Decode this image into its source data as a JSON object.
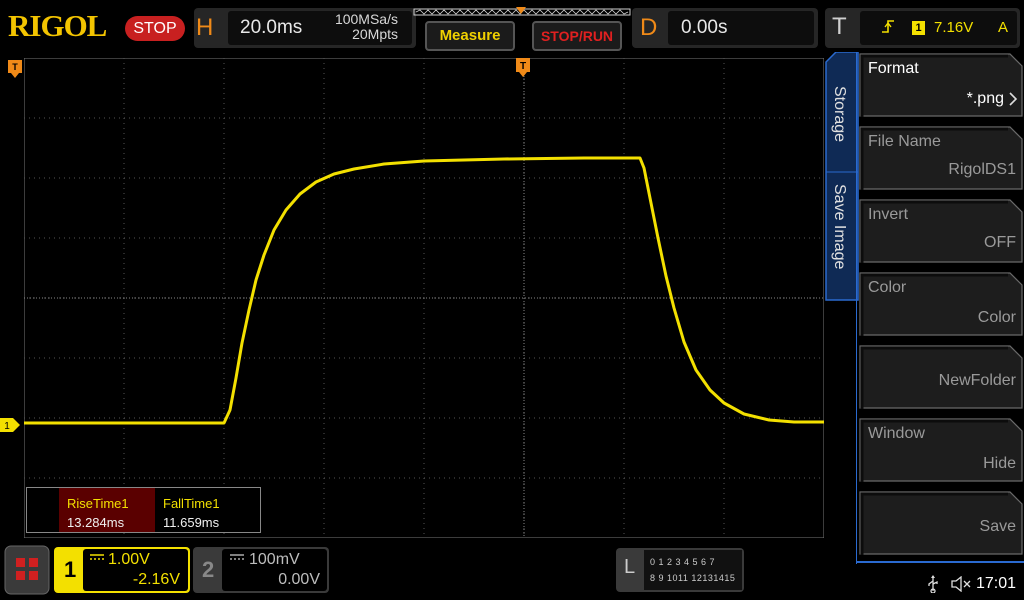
{
  "brand": {
    "logo": "RIGOL"
  },
  "run_state": {
    "badge": "STOP"
  },
  "horizontal": {
    "letter": "H",
    "timebase": "20.0ms",
    "sample_rate": "100MSa/s",
    "memory_depth": "20Mpts"
  },
  "buttons": {
    "measure": "Measure",
    "stop_run": "STOP/RUN"
  },
  "delay": {
    "letter": "D",
    "value": "0.00s"
  },
  "trigger": {
    "letter": "T",
    "channel": "1",
    "level": "7.16V",
    "mode": "A"
  },
  "measurements": [
    {
      "name": "RiseTime1",
      "value": "13.284ms"
    },
    {
      "name": "FallTime1",
      "value": "11.659ms"
    }
  ],
  "side_menu": {
    "tabs": [
      "Storage",
      "Save Image"
    ],
    "items": [
      {
        "label": "Format",
        "value": "*.png"
      },
      {
        "label": "File Name",
        "value": "RigolDS1"
      },
      {
        "label": "Invert",
        "value": "OFF"
      },
      {
        "label": "Color",
        "value": "Color"
      },
      {
        "label": "",
        "value": "NewFolder"
      },
      {
        "label": "Window",
        "value": "Hide"
      },
      {
        "label": "",
        "value": "Save"
      }
    ]
  },
  "channels": [
    {
      "number": "1",
      "scale": "1.00V",
      "offset": "-2.16V",
      "color": "#f3e000"
    },
    {
      "number": "2",
      "scale": "100mV",
      "offset": "0.00V",
      "color": "#00e0ff"
    }
  ],
  "logic": {
    "letter": "L",
    "row1": "0 1 2 3  4 5 6 7",
    "row2": "8 9 1011 12131415"
  },
  "status": {
    "time": "17:01"
  },
  "markers": {
    "ch1": "1"
  },
  "colors": {
    "accent": "#f08a18",
    "ch1": "#f3e000",
    "stop": "#c82020",
    "menu_blue": "#1c4fa0"
  }
}
